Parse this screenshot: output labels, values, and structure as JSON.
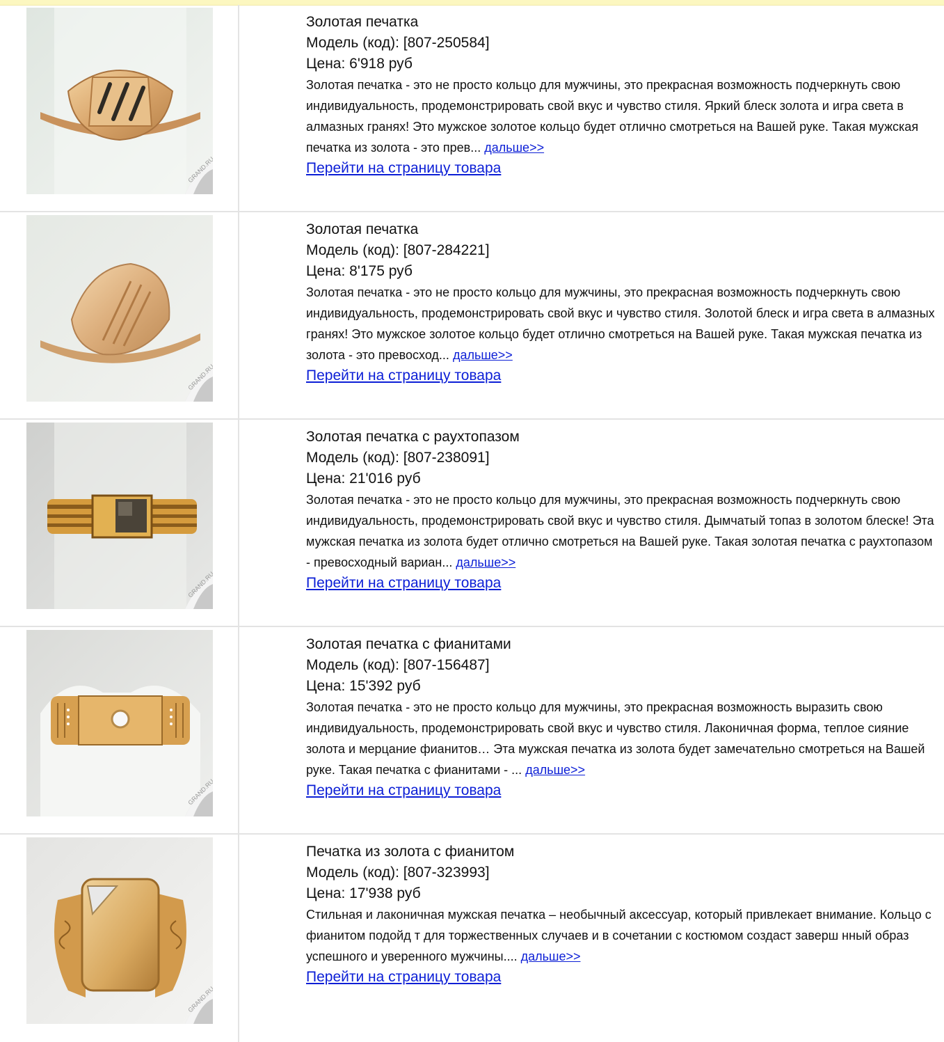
{
  "items": [
    {
      "title": "Золотая печатка",
      "code": "Модель (код): [807-250584]",
      "price": "Цена: 6'918 руб",
      "description": "Золотая печатка - это не просто кольцо для мужчины, это прекрасная возможность подчеркнуть свою индивидуальность, продемонстрировать свой вкус и чувство стиля. Яркий блеск золота и игра света в алмазных гранях! Это мужское золотое кольцо будет отлично смотреться на Вашей руке. Такая мужская печатка из золота - это прев...",
      "more_label": "дальше>>",
      "goto_label": "Перейти на страницу товара",
      "watermark": "GRAND.RU"
    },
    {
      "title": "Золотая печатка",
      "code": "Модель (код): [807-284221]",
      "price": "Цена: 8'175 руб",
      "description": "Золотая печатка - это не просто кольцо для мужчины, это прекрасная возможность подчеркнуть свою индивидуальность, продемонстрировать свой вкус и чувство стиля. Золотой блеск и игра света в алмазных гранях! Это мужское золотое кольцо будет отлично смотреться на Вашей руке. Такая мужская печатка из золота - это превосход...",
      "more_label": "дальше>>",
      "goto_label": "Перейти на страницу товара",
      "watermark": "GRAND.RU"
    },
    {
      "title": "Золотая печатка с раухтопазом",
      "code": "Модель (код): [807-238091]",
      "price": "Цена: 21'016 руб",
      "description": "Золотая печатка - это не просто кольцо для мужчины, это прекрасная возможность подчеркнуть свою индивидуальность, продемонстрировать свой вкус и чувство стиля. Дымчатый топаз в золотом блеске! Эта мужская печатка из золота будет отлично смотреться на Вашей руке. Такая золотая печатка с раухтопазом - превосходный вариан...",
      "more_label": "дальше>>",
      "goto_label": "Перейти на страницу товара",
      "watermark": "GRAND.RU"
    },
    {
      "title": "Золотая печатка с фианитами",
      "code": "Модель (код): [807-156487]",
      "price": "Цена: 15'392 руб",
      "description": "Золотая печатка - это не просто кольцо для мужчины, это прекрасная возможность выразить свою индивидуальность, продемонстрировать свой вкус и чувство стиля. Лаконичная форма, теплое сияние золота и мерцание фианитов… Эта мужская печатка из золота будет замечательно смотреться на Вашей руке. Такая печатка с фианитами - ...",
      "more_label": "дальше>>",
      "goto_label": "Перейти на страницу товара",
      "watermark": "GRAND.RU"
    },
    {
      "title": "Печатка из золота с фианитом",
      "code": "Модель (код): [807-323993]",
      "price": "Цена: 17'938 руб",
      "description": "Стильная и лаконичная мужская печатка – необычный аксессуар, который привлекает внимание. Кольцо с фианитом подойд  т для торжественных случаев и в сочетании с костюмом создаст заверш  нный образ успешного и уверенного мужчины....",
      "more_label": "дальше>>",
      "goto_label": "Перейти на страницу товара",
      "watermark": "GRAND.RU"
    }
  ]
}
